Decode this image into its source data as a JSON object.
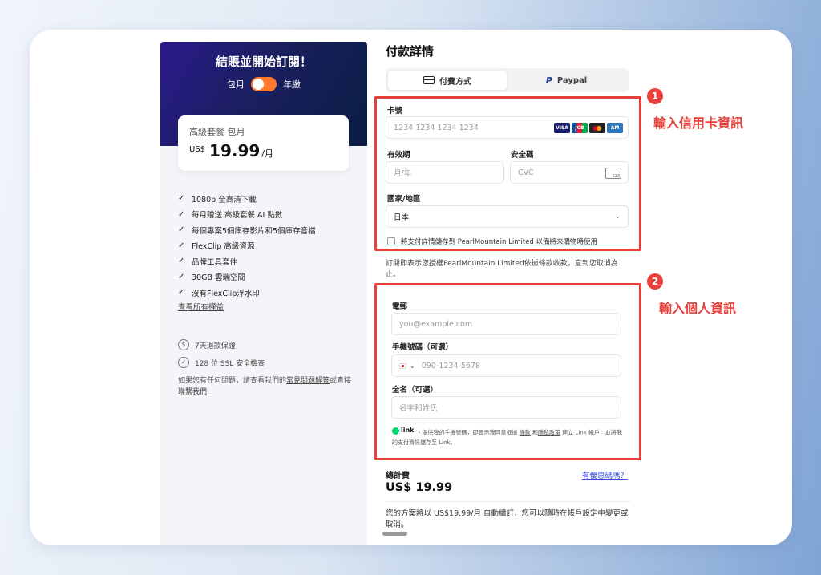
{
  "plan_panel": {
    "title": "結賬並開始訂閱！",
    "billing_monthly": "包月",
    "billing_yearly": "年繳",
    "plan_name": "高級套餐 包月",
    "currency": "US$",
    "price": "19.99",
    "period": "/月",
    "features": [
      "1080p 全高清下載",
      "每月贈送 高級套餐 AI 點數",
      "每個專案5個庫存影片和5個庫存音檔",
      "FlexClip 高級資源",
      "品牌工具套件",
      "30GB 雲端空間",
      "沒有FlexClip浮水印"
    ],
    "view_all": "查看所有權益",
    "guarantee_refund": "7天退款保證",
    "guarantee_ssl": "128 位 SSL 安全檢查",
    "help_prefix": "如果您有任何問題，請查看我們的",
    "help_faq": "常見問題解答",
    "help_mid": "或直接",
    "help_contact": "聯繫我們"
  },
  "payment": {
    "title": "付款詳情",
    "tab_card": "付費方式",
    "tab_paypal": "Paypal",
    "card_number_label": "卡號",
    "card_number_placeholder": "1234 1234 1234 1234",
    "expiry_label": "有效期",
    "expiry_placeholder": "月/年",
    "cvc_label": "安全碼",
    "cvc_placeholder": "CVC",
    "country_label": "國家/地區",
    "country_value": "日本",
    "save_details": "將支付詳情儲存到 PearlMountain Limited 以備將來購物時使用",
    "terms": "訂閱即表示您授權PearlMountain Limited依據條款收款，直到您取消為止。",
    "email_label": "電郵",
    "email_placeholder": "you@example.com",
    "phone_label": "手機號碼（可選）",
    "phone_placeholder": "090-1234-5678",
    "name_label": "全名（可選）",
    "name_placeholder": "名字和姓氏",
    "link_brand": "link",
    "link_text_1": "・提供我的手機號碼，即表示我同意根據 ",
    "link_terms": "條款",
    "link_and": " 和",
    "link_privacy": "隱私政策",
    "link_text_2": " 建立 Link 帳戶，並將我的支付資訊儲存至 Link。",
    "total_label": "總計費",
    "total_value": "US$ 19.99",
    "promo": "有優惠碼嗎？",
    "renew": "您的方案將以 US$19.99/月 自動續訂，您可以隨時在帳戶設定中變更或取消。"
  },
  "annotations": {
    "step1_number": "1",
    "step1_text": "輸入信用卡資訊",
    "step2_number": "2",
    "step2_text": "輸入個人資訊"
  },
  "colors": {
    "accent_red": "#e8403a",
    "toggle_orange": "#ff7a2e",
    "link_blue": "#3b4bd8"
  }
}
